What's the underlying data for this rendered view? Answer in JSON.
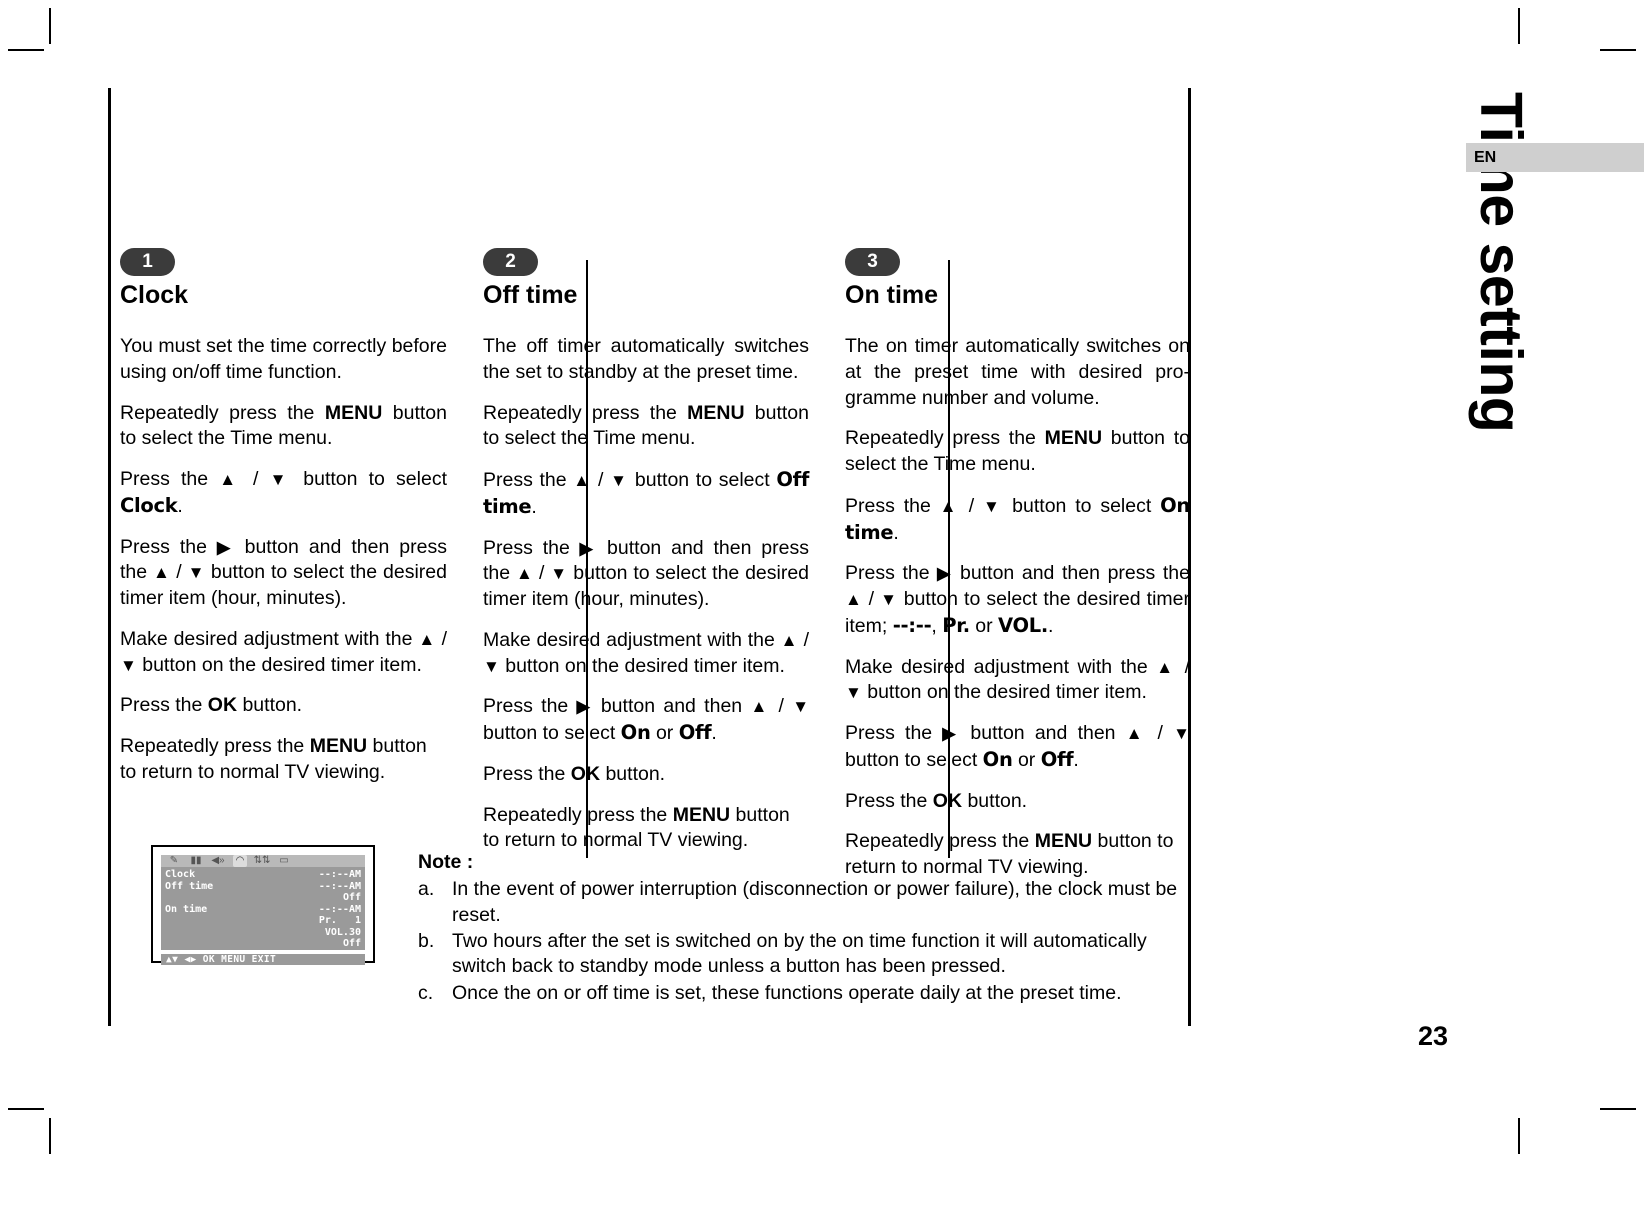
{
  "side_title": "Time setting",
  "language_tab": "EN",
  "page_number": "23",
  "columns": [
    {
      "badge": "1",
      "heading": "Clock",
      "paragraphs": [
        "You must set the time correctly before using on/off time function.",
        "Repeatedly press the MENU button to select the Time menu.",
        "Press the ▲ / ▼ button to select Clock.",
        "Press the ▶ button and then press the ▲ / ▼ button to select the desired timer item (hour, minutes).",
        "Make desired adjustment with the ▲ / ▼ button on the desired timer item.",
        "Press the OK button.",
        "Repeatedly press the MENU button to return to normal TV viewing."
      ]
    },
    {
      "badge": "2",
      "heading": "Off time",
      "paragraphs": [
        "The off timer automatically switches the set to standby at the preset time.",
        "Repeatedly press the MENU button to select the Time menu.",
        "Press the ▲ / ▼ button to select Off time.",
        "Press the ▶ button and then press the ▲ / ▼ button to select the desired timer item (hour, minutes).",
        "Make desired adjustment with the ▲ / ▼ button on the desired timer item.",
        "Press the ▶ button and then ▲ / ▼ button to select On or Off.",
        "Press the OK button.",
        "Repeatedly press the MENU button to return to normal TV viewing."
      ]
    },
    {
      "badge": "3",
      "heading": "On time",
      "paragraphs": [
        "The on timer automatically switches on at the preset time with desired pro-gramme number and volume.",
        "Repeatedly press the MENU button to select the Time menu.",
        "Press the ▲ / ▼ button to select On time.",
        "Press the ▶ button and then press the ▲ / ▼ button to select the desired timer item; --:--, Pr. or VOL..",
        "Make desired adjustment with the ▲ / ▼ button on the desired timer item.",
        "Press the ▶ button and then ▲ / ▼ button to select On or Off.",
        "Press the OK button.",
        "Repeatedly press the MENU button to return to normal TV viewing."
      ]
    }
  ],
  "osd": {
    "icons": [
      "pencil-icon",
      "picture-icon",
      "sound-icon",
      "clock-icon",
      "setup-icon",
      "screen-icon"
    ],
    "selected_icon_index": 3,
    "rows": [
      {
        "label": "Clock",
        "value": "--:--AM",
        "highlighted": true
      },
      {
        "label": "Off time",
        "value": "--:--AM",
        "highlighted": false
      },
      {
        "label": "",
        "value": "Off",
        "highlighted": false
      },
      {
        "label": "On time",
        "value": "--:--AM",
        "highlighted": false
      },
      {
        "label": "",
        "value": "Pr.   1",
        "highlighted": false
      },
      {
        "label": "",
        "value": "VOL.30",
        "highlighted": false
      },
      {
        "label": "",
        "value": "Off",
        "highlighted": false
      }
    ],
    "navbar": "▲▼ ◀▶ OK MENU EXIT"
  },
  "notes": {
    "title": "Note :",
    "items": [
      {
        "marker": "a.",
        "text": "In the event of power interruption (disconnection or power failure), the clock must be reset."
      },
      {
        "marker": "b.",
        "text": "Two hours after the set is switched on by the on time function it will automatically switch back to standby mode unless a button has been pressed."
      },
      {
        "marker": "c.",
        "text": "Once the on or off time is set, these functions operate daily at the preset time."
      }
    ]
  },
  "colors": {
    "badge_bg": "#3b3b3b",
    "lang_tab_bg": "#cfcfcf",
    "osd_body_bg": "#9a9a9a",
    "osd_iconbar_bg": "#b9b9b9"
  }
}
